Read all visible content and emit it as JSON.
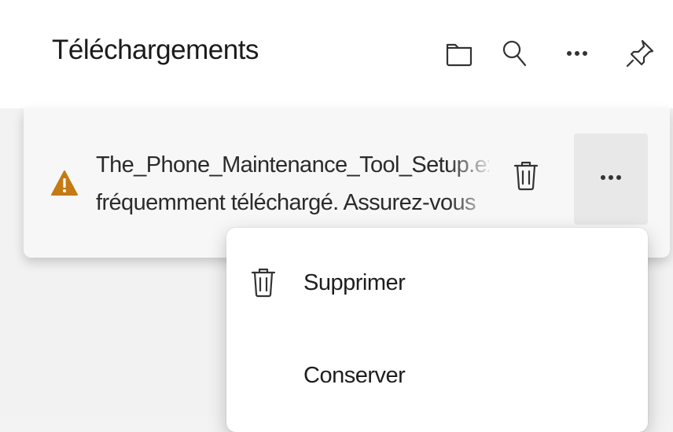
{
  "header": {
    "title": "Téléchargements",
    "icons": [
      "folder-icon",
      "search-icon",
      "more-icon",
      "pin-icon"
    ]
  },
  "item": {
    "line1": "The_Phone_Maintenance_Tool_Setup.exe",
    "line2": "fréquemment téléchargé. Assurez-vous",
    "warning_color": "#c57a13"
  },
  "menu": {
    "items": [
      {
        "label": "Supprimer",
        "icon": "trash-icon"
      },
      {
        "label": "Conserver",
        "icon": ""
      }
    ]
  }
}
